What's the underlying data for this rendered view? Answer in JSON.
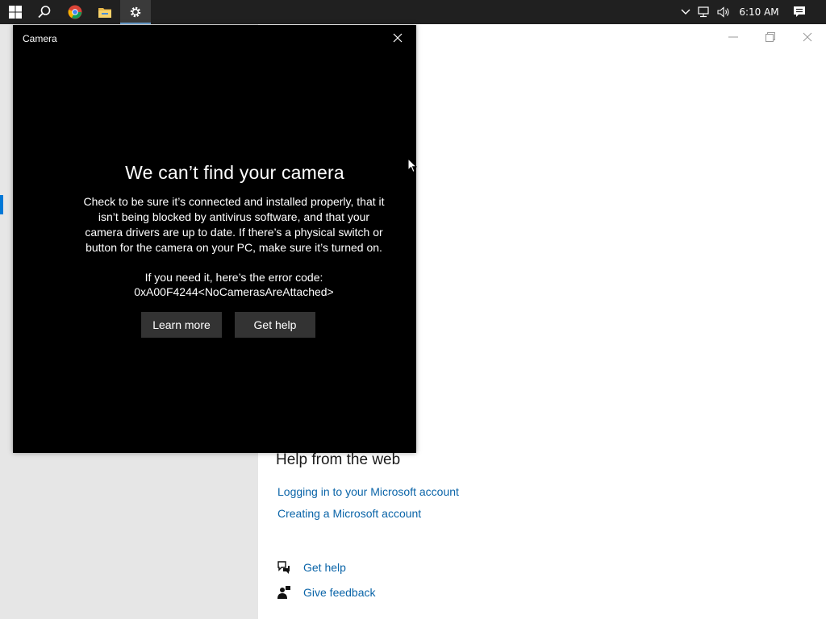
{
  "taskbar": {
    "icons": [
      "windows-start-icon",
      "search-icon",
      "chrome-icon",
      "file-explorer-icon",
      "settings-icon"
    ],
    "tray_icons": [
      "chevron-up-icon",
      "network-icon",
      "volume-icon",
      "notification-icon"
    ],
    "time": "6:10 AM"
  },
  "camera_dialog": {
    "title": "Camera",
    "heading": "We can’t find your camera",
    "body": "Check to be sure it’s connected and installed properly, that it isn’t being blocked by antivirus software, and that your camera drivers are up to date. If there’s a physical switch or button for the camera on your PC, make sure it’s turned on.",
    "error_intro": "If you need it, here’s the error code:",
    "error_code": "0xA00F4244<NoCamerasAreAttached>",
    "learn_more": "Learn more",
    "get_help": "Get help"
  },
  "settings": {
    "help_from_web": "Help from the web",
    "links": [
      "Logging in to your Microsoft account",
      "Creating a Microsoft account"
    ],
    "get_help": "Get help",
    "give_feedback": "Give feedback"
  },
  "colors": {
    "taskbar_bg": "#202020",
    "accent": "#0078d7",
    "link": "#0a64a8",
    "dialog_bg": "#000000",
    "button_bg": "#333333"
  }
}
